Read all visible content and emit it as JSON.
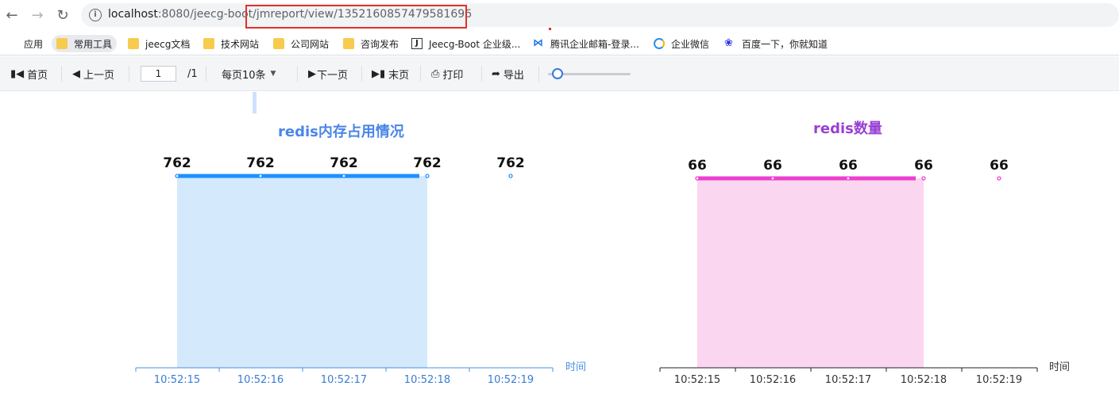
{
  "browser": {
    "url_host": "localhost",
    "url_rest": ":8080/jeecg-boot/jmreport/view/1352160857479581696"
  },
  "bookmarks": [
    {
      "label": "应用",
      "icon": "apps-grid-icon"
    },
    {
      "label": "常用工具",
      "icon": "folder-icon"
    },
    {
      "label": "jeecg文档",
      "icon": "folder-icon"
    },
    {
      "label": "技术网站",
      "icon": "folder-icon"
    },
    {
      "label": "公司网站",
      "icon": "folder-icon"
    },
    {
      "label": "咨询发布",
      "icon": "folder-icon"
    },
    {
      "label": "Jeecg-Boot 企业级...",
      "icon": "j-favicon-icon"
    },
    {
      "label": "腾讯企业邮箱-登录...",
      "icon": "tencent-mail-icon"
    },
    {
      "label": "企业微信",
      "icon": "wecom-icon"
    },
    {
      "label": "百度一下，你就知道",
      "icon": "baidu-paw-icon"
    }
  ],
  "toolbar": {
    "first": "首页",
    "prev": "上一页",
    "page_value": "1",
    "page_total": "/1",
    "per_page": "每页10条",
    "next": "下一页",
    "last": "末页",
    "print": "打印",
    "export": "导出",
    "zoom_fraction": 0.05
  },
  "chart_data": [
    {
      "type": "area",
      "title": "redis内存占用情况",
      "xlabel": "时间",
      "categories": [
        "10:52:15",
        "10:52:16",
        "10:52:17",
        "10:52:18",
        "10:52:19"
      ],
      "values": [
        762,
        762,
        762,
        762,
        762
      ],
      "fill_through_index": 3,
      "colors": {
        "title": "#4a86e8",
        "line": "#1e90ff",
        "fill": "#d4e9fc",
        "axis": "#4a90e2",
        "tick_label": "#3a7bd5",
        "xlabel": "#4a90e2"
      }
    },
    {
      "type": "area",
      "title": "redis数量",
      "xlabel": "时间",
      "categories": [
        "10:52:15",
        "10:52:16",
        "10:52:17",
        "10:52:18",
        "10:52:19"
      ],
      "values": [
        66,
        66,
        66,
        66,
        66
      ],
      "fill_through_index": 3,
      "colors": {
        "title": "#9a3fd4",
        "line": "#ee3fd0",
        "fill": "#fad6f0",
        "axis": "#222222",
        "tick_label": "#333333",
        "xlabel": "#333333"
      }
    }
  ]
}
